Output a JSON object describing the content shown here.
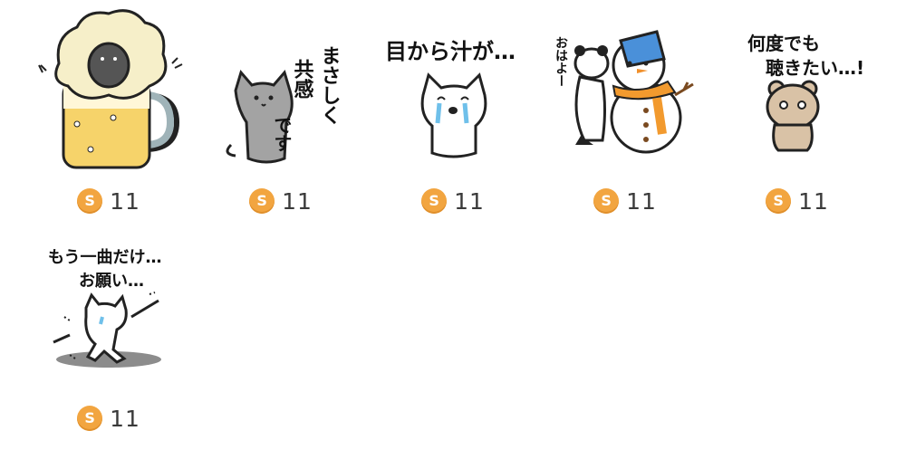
{
  "coin_icon": "coin-icon",
  "colors": {
    "coin": "#f2a540",
    "count_text": "#3a3a3a"
  },
  "stickers": [
    {
      "name": "sheep-beer-mug-sticker",
      "caption": "",
      "price": "11"
    },
    {
      "name": "gray-cat-sympathy-sticker",
      "caption_lines": [
        "まさしく",
        "共感",
        "です"
      ],
      "price": "11"
    },
    {
      "name": "crying-cat-sticker",
      "caption": "目から汁が…",
      "price": "11"
    },
    {
      "name": "panda-snowman-sticker",
      "caption": "おはよー",
      "price": "11"
    },
    {
      "name": "bear-listen-again-sticker",
      "caption_lines": [
        "何度でも",
        "聴きたい…!"
      ],
      "price": "11"
    },
    {
      "name": "dancing-cat-sticker",
      "caption_lines": [
        "もう一曲だけ…",
        "お願い…"
      ],
      "price": "11"
    }
  ]
}
